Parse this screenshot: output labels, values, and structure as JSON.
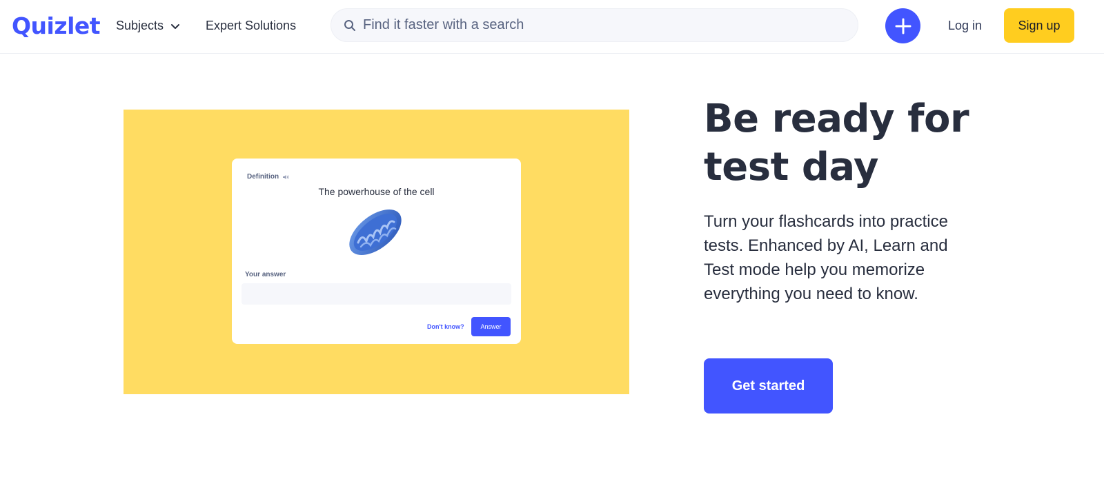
{
  "header": {
    "logo": "Quizlet",
    "nav": {
      "subjects_label": "Subjects",
      "expert_label": "Expert Solutions"
    },
    "search": {
      "placeholder": "Find it faster with a search",
      "icon": "search-icon"
    },
    "create_icon": "plus-icon",
    "login_label": "Log in",
    "signup_label": "Sign up"
  },
  "hero": {
    "title": "Be ready for test day",
    "description": "Turn your flashcards into practice tests. Enhanced by AI, Learn and Test mode help you memorize everything you need to know.",
    "cta_label": "Get started"
  },
  "preview_card": {
    "definition_label": "Definition",
    "term": "The powerhouse of the cell",
    "answer_label": "Your answer",
    "dont_know_label": "Don't know?",
    "answer_button_label": "Answer"
  },
  "colors": {
    "brand": "#4255ff",
    "signup_bg": "#ffcd1f",
    "hero_image_bg": "#ffdc62",
    "text_dark": "#282e3e"
  }
}
